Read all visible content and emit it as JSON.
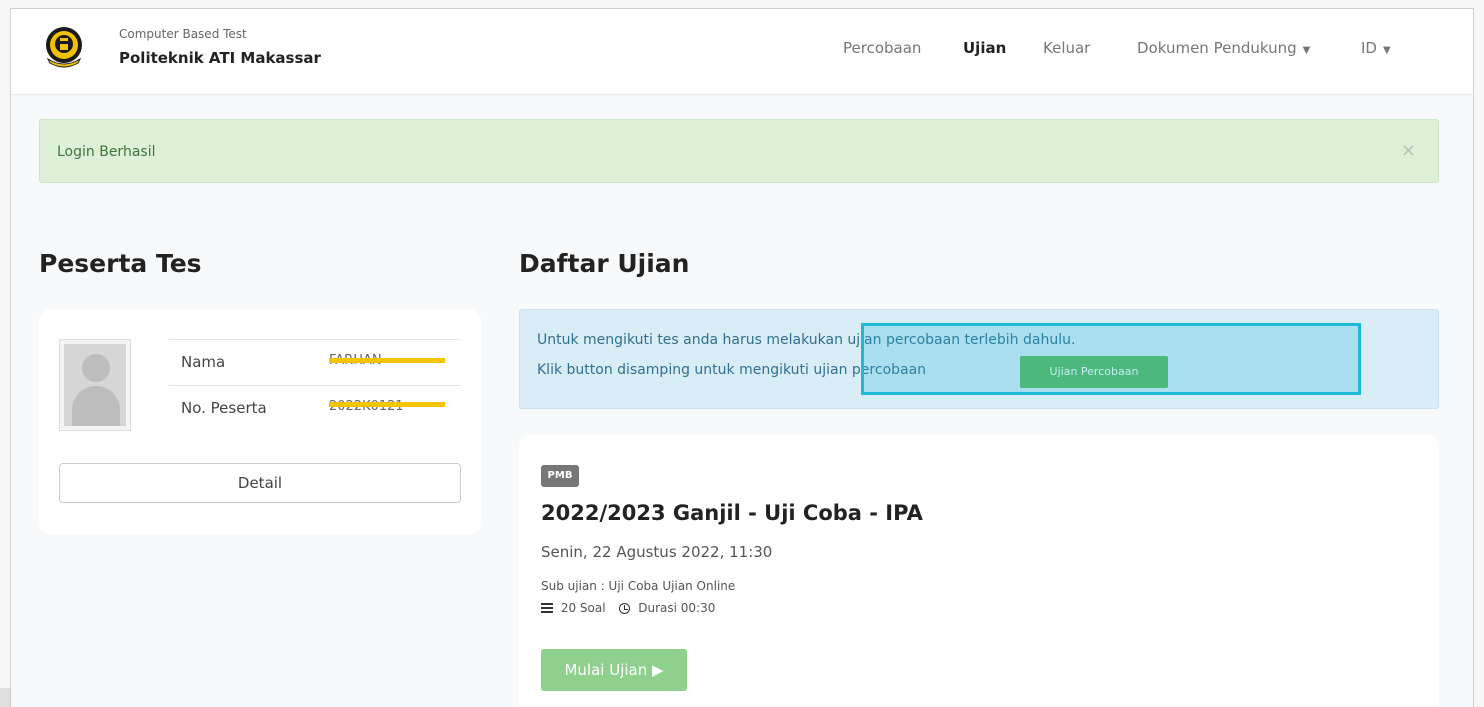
{
  "brand": {
    "subtitle": "Computer Based Test",
    "title": "Politeknik ATI Makassar"
  },
  "nav": {
    "items": [
      {
        "label": "Percobaan",
        "active": false
      },
      {
        "label": "Ujian",
        "active": true
      },
      {
        "label": "Keluar",
        "active": false
      },
      {
        "label": "Dokumen Pendukung",
        "active": false,
        "dropdown": true
      },
      {
        "label": "ID",
        "active": false,
        "dropdown": true
      }
    ]
  },
  "alert_success": {
    "message": "Login Berhasil",
    "close_symbol": "×"
  },
  "peserta": {
    "heading": "Peserta Tes",
    "rows": [
      {
        "label": "Nama",
        "value": "FARHAN"
      },
      {
        "label": "No. Peserta",
        "value": "2022K0121"
      }
    ],
    "detail_label": "Detail"
  },
  "daftar": {
    "heading": "Daftar Ujian",
    "info_line1": "Untuk mengikuti tes anda harus melakukan ujian percobaan terlebih dahulu.",
    "info_line2": "Klik button disamping untuk mengikuti ujian percobaan",
    "percobaan_button": "Ujian Percobaan"
  },
  "exam": {
    "badge": "PMB",
    "title": "2022/2023 Ganjil - Uji Coba - IPA",
    "date": "Senin, 22 Agustus 2022, 11:30",
    "sub": "Sub ujian : Uji Coba Ujian Online",
    "soal": "20 Soal",
    "durasi": "Durasi 00:30",
    "start_label": "Mulai Ujian ▶"
  },
  "colors": {
    "success_bg": "#dff0d8",
    "info_bg": "#d9edf7",
    "button_green": "#5cb85c",
    "highlight": "#1eb8d8",
    "redaction": "#f5c400"
  }
}
